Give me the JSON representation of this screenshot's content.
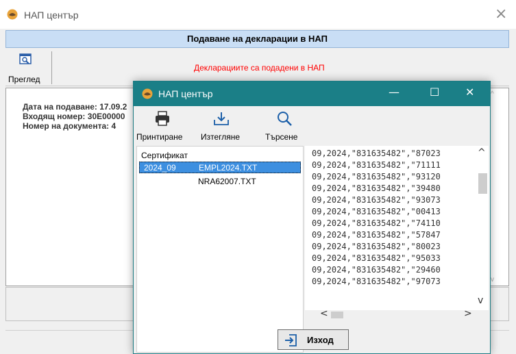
{
  "outer_window": {
    "title": "НАП център",
    "header": "Подаване на декларации в НАП",
    "preview_label": "Преглед",
    "status_message": "Декларациите са подадени в НАП",
    "info": {
      "submitted_date": "Дата на подаване: 17.09.2",
      "incoming_number": "Входящ номер: 30E00000",
      "document_number": "Номер на документа: 4"
    }
  },
  "dialog": {
    "title": "НАП център",
    "toolbar": {
      "print_label": "Принтиране",
      "download_label": "Изтегляне",
      "search_label": "Търсене"
    },
    "file_list": {
      "header": "Сертификат",
      "selected": {
        "period": "2024_09",
        "file": "EMPL2024.TXT"
      },
      "other_file": "NRA62007.TXT"
    },
    "text_lines": [
      "09,2024,\"831635482\",\"87023",
      "09,2024,\"831635482\",\"71111",
      "09,2024,\"831635482\",\"93120",
      "09,2024,\"831635482\",\"39480",
      "09,2024,\"831635482\",\"93073",
      "09,2024,\"831635482\",\"00413",
      "09,2024,\"831635482\",\"74110",
      "09,2024,\"831635482\",\"57847",
      "09,2024,\"831635482\",\"80023",
      "09,2024,\"831635482\",\"95033",
      "09,2024,\"831635482\",\"29460",
      "09,2024,\"831635482\",\"97073"
    ],
    "exit_label": "Изход"
  }
}
